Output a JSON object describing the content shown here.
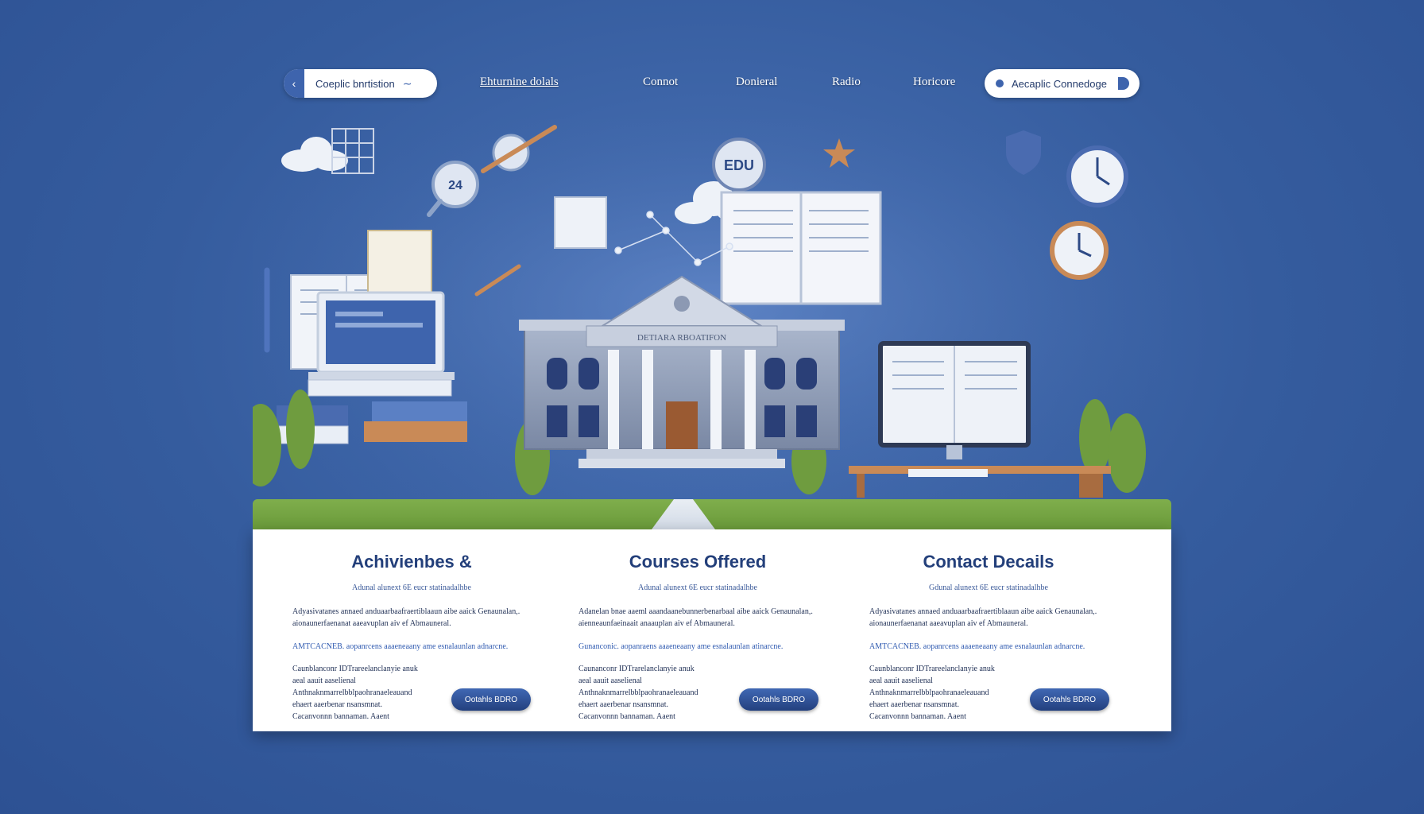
{
  "nav": {
    "search_label": "Coeplic bnrtistion",
    "links": [
      "Ehturnine dolals",
      "Connot",
      "Donieral",
      "Radio",
      "Horicore"
    ],
    "cta_label": "Aecaplic Connedoge"
  },
  "hero": {
    "building_sign": "DETIARA RBOATIFON",
    "badge_text": "EDU",
    "badge_number": "24"
  },
  "sections": [
    {
      "title": "Achivienbes &",
      "subtitle": "Adunal alunext 6E eucr statinadalhbe",
      "p1": "Adyasivatanes annaed anduaarbaafraertiblaaun aibe aaick Genaunalan,. aionaunerfaenanat aaeavuplan aiv ef Abmauneral.",
      "p2": "AMTCACNEB. aopanrcens aaaeneaany ame esnalaunlan adnarcne.",
      "p3": "Caunblanconr IDTrareelanclanyie anuk aeal aauit aaselienal Anthnaknmarrelbblpaohranaeleauand ehaert aaerbenar nsansmnat. Cacanvonnn bannaman. Aaent",
      "button": "Ootahls BDRO"
    },
    {
      "title": "Courses Offered",
      "subtitle": "Adunal alunext 6E eucr statinadalhbe",
      "p1": "Adanelan bnae aaeml aaandaanebunnerbenarbaal aibe aaick Genaunalan,. aienneaunfaeinaait anaauplan aiv ef Abmauneral.",
      "p2": "Gunanconic. aopanraens aaaeneaany ame esnalaunlan atinarcne.",
      "p3": "Caunanconr IDTrarelanclanyie anuk aeal aauit aaselienal Anthnaknmarrelbblpaohranaeleauand ehaert aaerbenar nsansmnat. Cacanvonnn bannaman. Aaent",
      "button": "Ootahls BDRO"
    },
    {
      "title": "Contact Decails",
      "subtitle": "Gdunal alunext 6E eucr statinadalhbe",
      "p1": "Adyasivatanes annaed anduaarbaafraertiblaaun aibe aaick Genaunalan,. aionaunerfaenanat aaeavuplan aiv ef Abmauneral.",
      "p2": "AMTCACNEB. aopanrcens aaaeneaany ame esnalaunlan adnarcne.",
      "p3": "Caunblanconr IDTrareelanclanyie anuk aeal aauit aaselienal Anthnaknmarrelbblpaohranaeleauand ehaert aaerbenar nsansmnat. Cacanvonnn bannaman. Aaent",
      "button": "Ootahls BDRO"
    }
  ],
  "colors": {
    "background": "#355c9e",
    "accent": "#3e64ad",
    "heading": "#233f7a",
    "grass": "#7fae4c"
  }
}
